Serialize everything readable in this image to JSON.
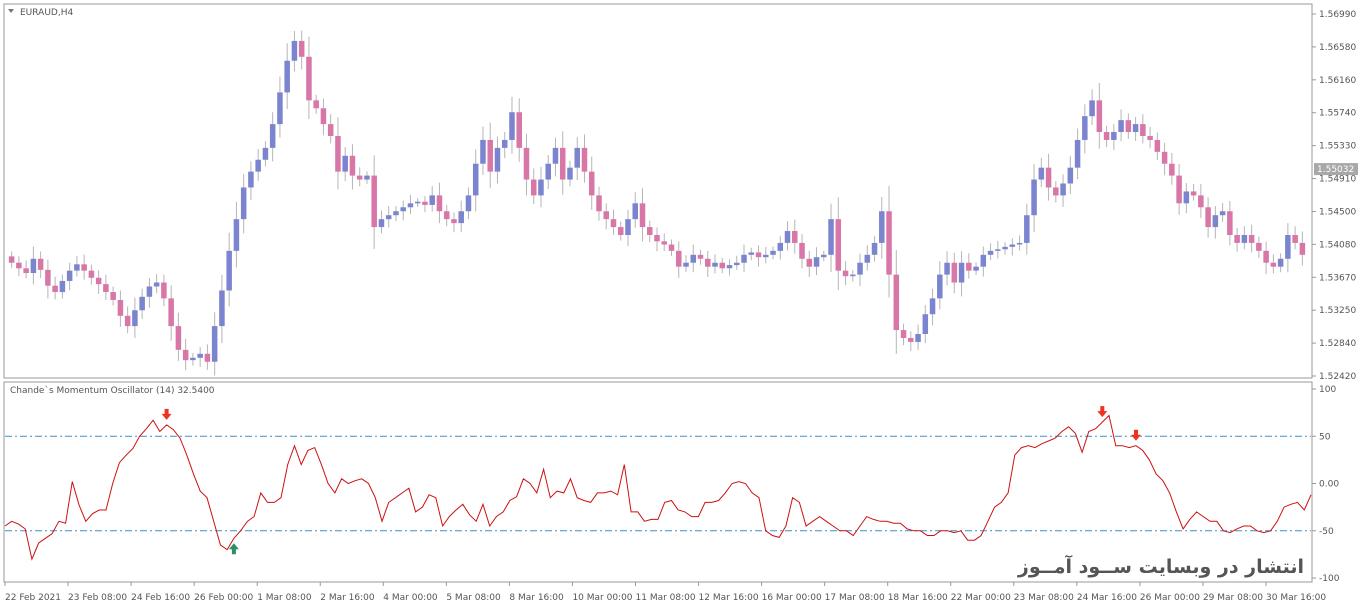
{
  "colors": {
    "bull": "#7b85cf",
    "bear": "#d876a8",
    "line": "#cc1111",
    "level": "#3a8fc8",
    "axis": "#999999",
    "text": "#555555",
    "current_price_bg": "#a8a8a8",
    "arrow_down": "#ee3322",
    "arrow_up": "#2f8f62"
  },
  "watermark": "انتشار در وبسایت ســود آمــوز",
  "chart_data": [
    {
      "type": "candlestick",
      "title": "EURAUD,H4",
      "current_price": "1.55032",
      "current_price_value": 1.55032,
      "ylim": [
        1.5242,
        1.5699
      ],
      "y_ticks": [
        "1.56990",
        "1.56580",
        "1.56160",
        "1.55740",
        "1.55330",
        "1.54910",
        "1.54500",
        "1.54080",
        "1.53670",
        "1.53250",
        "1.52840",
        "1.52420"
      ],
      "x_ticks": [
        "22 Feb 2021",
        "23 Feb 08:00",
        "24 Feb 16:00",
        "26 Feb 00:00",
        "1 Mar 08:00",
        "2 Mar 16:00",
        "4 Mar 00:00",
        "5 Mar 08:00",
        "8 Mar 16:00",
        "10 Mar 00:00",
        "11 Mar 08:00",
        "12 Mar 16:00",
        "16 Mar 00:00",
        "17 Mar 08:00",
        "18 Mar 16:00",
        "22 Mar 00:00",
        "23 Mar 08:00",
        "24 Mar 16:00",
        "26 Mar 00:00",
        "29 Mar 08:00",
        "30 Mar 16:00"
      ],
      "close_path": [
        1.5385,
        1.5378,
        1.5372,
        1.539,
        1.5376,
        1.5356,
        1.5348,
        1.5362,
        1.5375,
        1.5383,
        1.5375,
        1.5366,
        1.5358,
        1.5348,
        1.5338,
        1.5318,
        1.5305,
        1.5325,
        1.5342,
        1.5355,
        1.536,
        1.534,
        1.5305,
        1.5275,
        1.5262,
        1.5265,
        1.527,
        1.526,
        1.5305,
        1.535,
        1.54,
        1.544,
        1.548,
        1.55,
        1.5515,
        1.553,
        1.556,
        1.56,
        1.564,
        1.5665,
        1.5645,
        1.559,
        1.558,
        1.556,
        1.5545,
        1.55,
        1.552,
        1.5495,
        1.549,
        1.5495,
        1.543,
        1.544,
        1.5445,
        1.545,
        1.5455,
        1.546,
        1.5462,
        1.5458,
        1.547,
        1.545,
        1.544,
        1.5435,
        1.545,
        1.547,
        1.551,
        1.554,
        1.55,
        1.553,
        1.554,
        1.5575,
        1.553,
        1.549,
        1.547,
        1.549,
        1.551,
        1.553,
        1.549,
        1.5505,
        1.553,
        1.55,
        1.547,
        1.545,
        1.544,
        1.543,
        1.542,
        1.544,
        1.546,
        1.543,
        1.542,
        1.5412,
        1.5408,
        1.54,
        1.538,
        1.5385,
        1.5395,
        1.539,
        1.538,
        1.5385,
        1.5378,
        1.5382,
        1.5385,
        1.5395,
        1.5398,
        1.5392,
        1.5395,
        1.54,
        1.541,
        1.5425,
        1.541,
        1.539,
        1.538,
        1.5392,
        1.5395,
        1.544,
        1.5375,
        1.5368,
        1.537,
        1.5385,
        1.5395,
        1.541,
        1.545,
        1.537,
        1.53,
        1.529,
        1.5285,
        1.5295,
        1.532,
        1.534,
        1.537,
        1.5385,
        1.536,
        1.5385,
        1.5375,
        1.538,
        1.5395,
        1.54,
        1.5402,
        1.5405,
        1.5408,
        1.541,
        1.5445,
        1.549,
        1.5505,
        1.548,
        1.547,
        1.5485,
        1.5505,
        1.554,
        1.557,
        1.559,
        1.555,
        1.554,
        1.555,
        1.5565,
        1.555,
        1.556,
        1.5545,
        1.554,
        1.5525,
        1.551,
        1.5495,
        1.546,
        1.5475,
        1.547,
        1.5455,
        1.543,
        1.5445,
        1.545,
        1.542,
        1.541,
        1.542,
        1.541,
        1.54,
        1.5385,
        1.538,
        1.539,
        1.542,
        1.541,
        1.5395
      ]
    },
    {
      "type": "line",
      "title": "Chande`s Momentum Oscillator (14) 32.5400",
      "ylim": [
        -100,
        100
      ],
      "y_ticks": [
        "100",
        "50",
        "0.00",
        "-50",
        "-100"
      ],
      "levels": [
        50,
        -50
      ],
      "values": [
        -45,
        -40,
        -43,
        -48,
        -80,
        -63,
        -58,
        -53,
        -40,
        -42,
        2,
        -23,
        -40,
        -32,
        -28,
        -28,
        0,
        22,
        30,
        37,
        50,
        58,
        67,
        55,
        62,
        57,
        48,
        30,
        10,
        -8,
        -15,
        -40,
        -65,
        -70,
        -58,
        -50,
        -40,
        -35,
        -10,
        -20,
        -20,
        -15,
        20,
        40,
        20,
        35,
        38,
        20,
        0,
        -10,
        5,
        0,
        3,
        5,
        0,
        -15,
        -40,
        -20,
        -15,
        -10,
        -5,
        -30,
        -25,
        -12,
        -15,
        -45,
        -35,
        -28,
        -22,
        -33,
        -40,
        -22,
        -45,
        -35,
        -30,
        -18,
        -14,
        5,
        0,
        -10,
        15,
        -15,
        -8,
        -10,
        5,
        -15,
        -18,
        -20,
        -10,
        -10,
        -8,
        -12,
        20,
        -30,
        -30,
        -40,
        -38,
        -38,
        -20,
        -18,
        -28,
        -30,
        -35,
        -35,
        -20,
        -20,
        -18,
        -10,
        0,
        2,
        0,
        -10,
        -15,
        -50,
        -55,
        -57,
        -45,
        -15,
        -20,
        -45,
        -40,
        -35,
        -40,
        -45,
        -50,
        -50,
        -55,
        -45,
        -35,
        -38,
        -40,
        -40,
        -42,
        -42,
        -48,
        -50,
        -50,
        -55,
        -55,
        -50,
        -50,
        -52,
        -50,
        -60,
        -60,
        -55,
        -40,
        -25,
        -20,
        -10,
        30,
        38,
        40,
        38,
        42,
        45,
        48,
        55,
        60,
        53,
        33,
        55,
        58,
        65,
        72,
        40,
        40,
        38,
        40,
        35,
        25,
        10,
        3,
        -10,
        -30,
        -48,
        -38,
        -30,
        -35,
        -40,
        -40,
        -50,
        -52,
        -48,
        -45,
        -45,
        -50,
        -52,
        -50,
        -40,
        -25,
        -22,
        -20,
        -28,
        -12
      ],
      "signals": [
        {
          "index": 24,
          "dir": "down"
        },
        {
          "index": 34,
          "dir": "up"
        },
        {
          "index": 163,
          "dir": "down"
        },
        {
          "index": 168,
          "dir": "down"
        }
      ]
    }
  ]
}
